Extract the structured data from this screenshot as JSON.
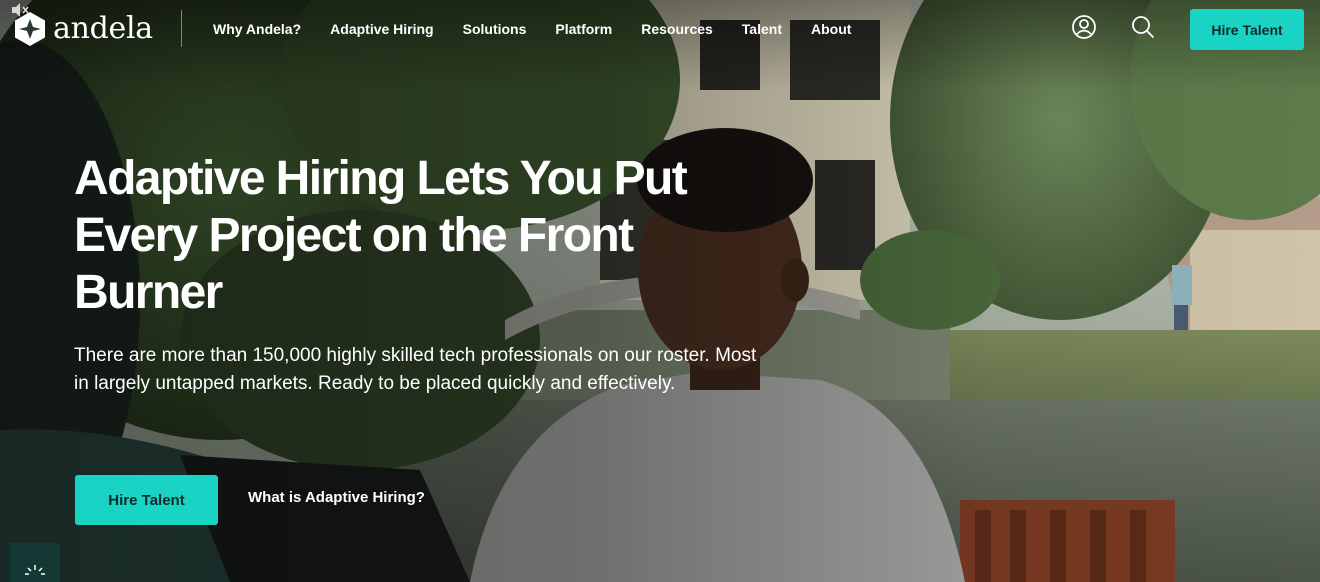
{
  "header": {
    "logo_text": "andela",
    "nav": [
      {
        "label": "Why Andela?"
      },
      {
        "label": "Adaptive Hiring"
      },
      {
        "label": "Solutions"
      },
      {
        "label": "Platform"
      },
      {
        "label": "Resources"
      },
      {
        "label": "Talent"
      },
      {
        "label": "About"
      }
    ],
    "icons": {
      "account": "user-circle-icon",
      "search": "search-icon",
      "mute": "speaker-muted-icon"
    },
    "cta_label": "Hire Talent"
  },
  "hero": {
    "title": "Adaptive Hiring Lets You Put Every Project on the Front Burner",
    "subtitle": "There are more than 150,000 highly skilled tech professionals on our roster. Most in largely untapped markets. Ready to be placed quickly and effectively.",
    "cta_label": "Hire Talent",
    "link_label": "What is Adaptive Hiring?"
  },
  "colors": {
    "accent": "#19d3c5",
    "accent_text": "#0b2c2a",
    "text": "#ffffff"
  }
}
